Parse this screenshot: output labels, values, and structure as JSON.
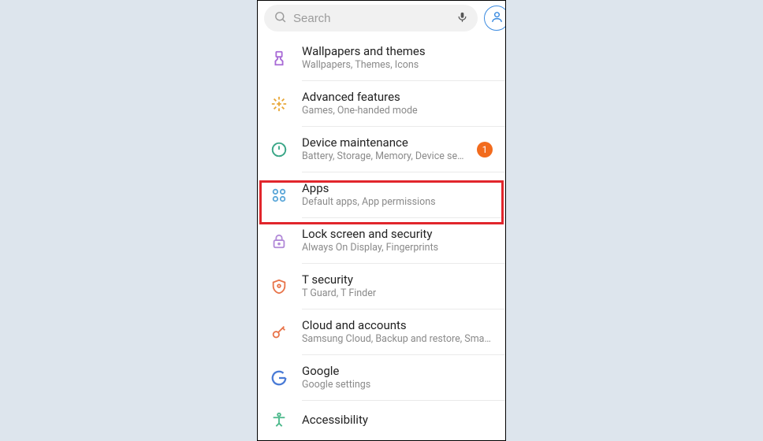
{
  "search": {
    "placeholder": "Search"
  },
  "settings": [
    {
      "key": "wallpapers",
      "title": "Wallpapers and themes",
      "subtitle": "Wallpapers, Themes, Icons",
      "icon": "brush-icon"
    },
    {
      "key": "advanced",
      "title": "Advanced features",
      "subtitle": "Games, One-handed mode",
      "icon": "plus-gear-icon"
    },
    {
      "key": "maintenance",
      "title": "Device maintenance",
      "subtitle": "Battery, Storage, Memory, Device se…",
      "icon": "power-cycle-icon",
      "badge": "1"
    },
    {
      "key": "apps",
      "title": "Apps",
      "subtitle": "Default apps, App permissions",
      "icon": "apps-grid-icon"
    },
    {
      "key": "lock",
      "title": "Lock screen and security",
      "subtitle": "Always On Display, Fingerprints",
      "icon": "lock-icon"
    },
    {
      "key": "tsecurity",
      "title": "T security",
      "subtitle": "T Guard, T Finder",
      "icon": "shield-icon"
    },
    {
      "key": "cloud",
      "title": "Cloud and accounts",
      "subtitle": "Samsung Cloud, Backup and restore, Smart…",
      "icon": "key-icon"
    },
    {
      "key": "google",
      "title": "Google",
      "subtitle": "Google settings",
      "icon": "google-icon"
    },
    {
      "key": "accessibility",
      "title": "Accessibility",
      "subtitle": "",
      "icon": "accessibility-icon"
    }
  ],
  "highlighted_key": "apps"
}
